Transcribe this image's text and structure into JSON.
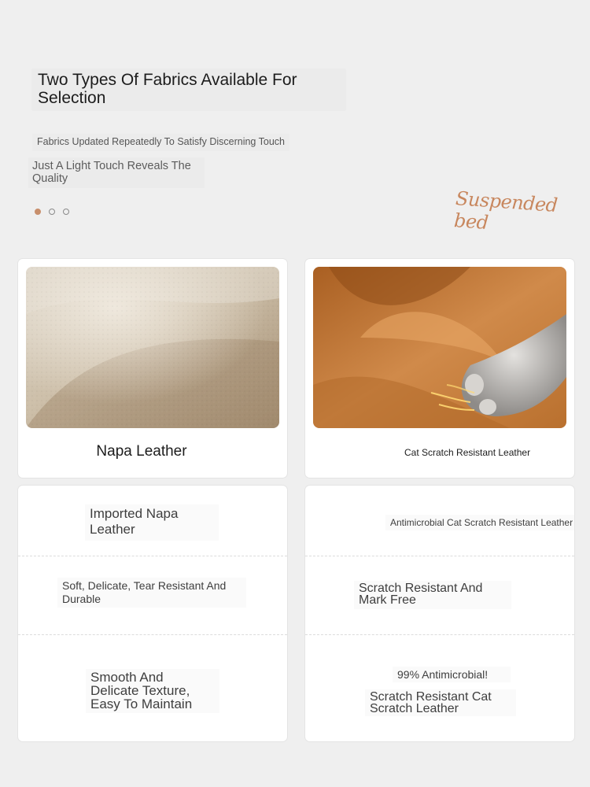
{
  "header": {
    "title_line1": "Two Types Of Fabrics Available For",
    "title_line2": "Selection",
    "subtitle": "Fabrics Updated Repeatedly To Satisfy Discerning Touch",
    "tagline_line1": "Just A Light Touch Reveals The",
    "tagline_line2": "Quality",
    "brand_script": "Suspended bed"
  },
  "carousel": {
    "slide_count": 3,
    "active_index": 0,
    "active_color": "#c88f6c"
  },
  "fabrics": [
    {
      "name": "Napa Leather",
      "photo_icon": "napa-leather-swatch-image"
    },
    {
      "name": "Cat Scratch Resistant Leather",
      "photo_icon": "cat-paw-on-leather-image"
    }
  ],
  "features": {
    "napa": {
      "row1_line1": "Imported Napa",
      "row1_line2": "Leather",
      "row2_line1": "Soft, Delicate, Tear Resistant And",
      "row2_line2": "Durable",
      "row3_line1": "Smooth And",
      "row3_line2": "Delicate Texture,",
      "row3_line3": "Easy To Maintain"
    },
    "cat": {
      "row1": "Antimicrobial Cat Scratch Resistant Leather",
      "row2_line1": "Scratch Resistant And",
      "row2_line2": "Mark Free",
      "row3_badge": "99% Antimicrobial!",
      "row3_line1": "Scratch Resistant Cat",
      "row3_line2": "Scratch Leather"
    }
  },
  "colors": {
    "page_bg": "#efefef",
    "accent": "#c8875e",
    "napa_leather": "#c9bdaa",
    "cat_leather": "#c47f3e"
  }
}
